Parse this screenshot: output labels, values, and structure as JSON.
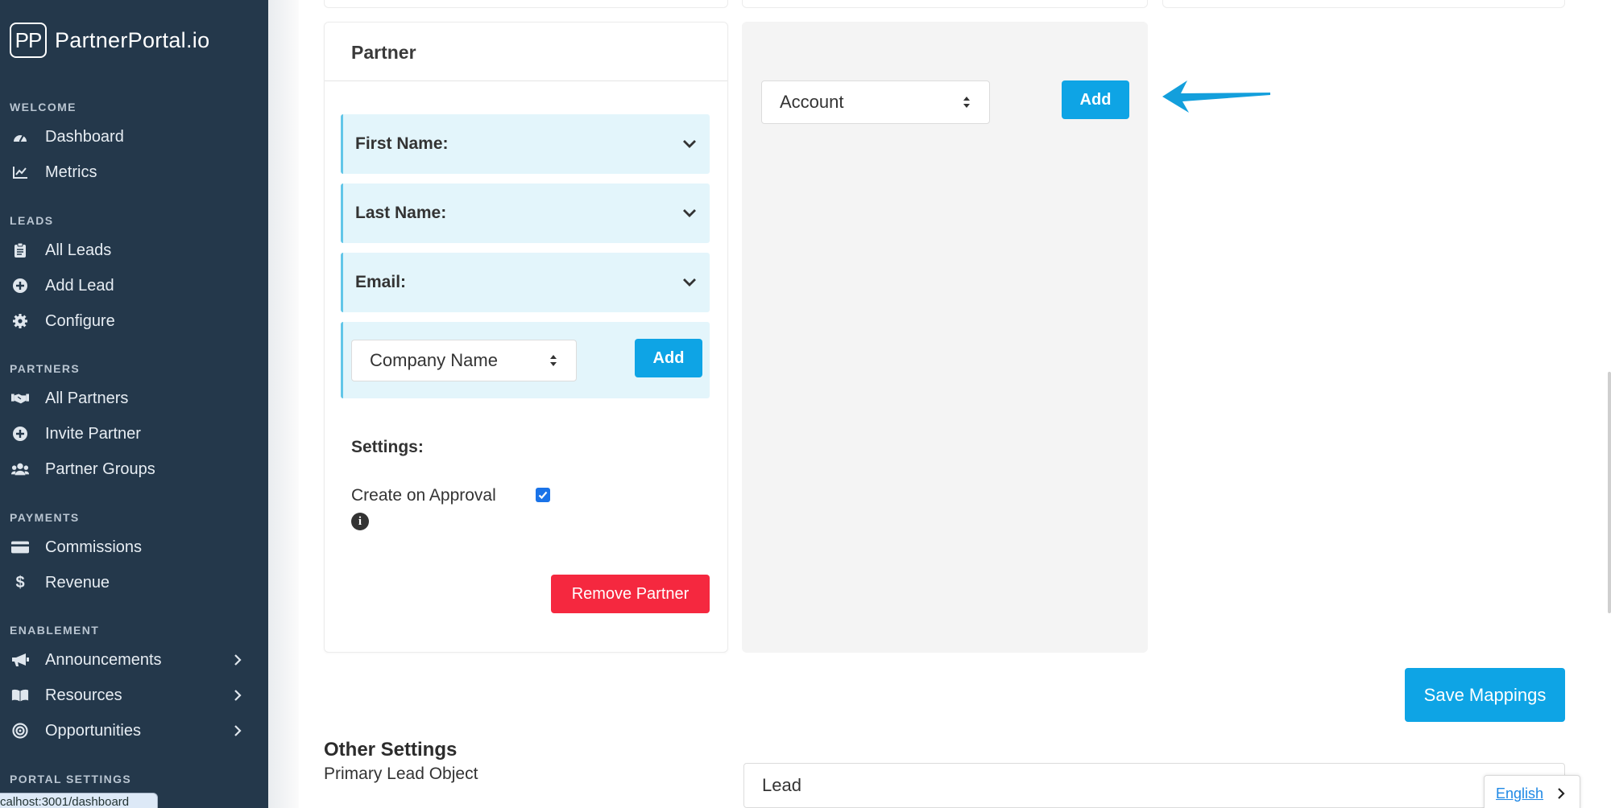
{
  "brand": {
    "mark": "PP",
    "name": "PartnerPortal.io"
  },
  "sidebar": {
    "sections": [
      {
        "label": "WELCOME",
        "items": [
          {
            "label": "Dashboard",
            "icon": "gauge-icon"
          },
          {
            "label": "Metrics",
            "icon": "chart-line-icon"
          }
        ]
      },
      {
        "label": "LEADS",
        "items": [
          {
            "label": "All Leads",
            "icon": "clipboard-icon"
          },
          {
            "label": "Add Lead",
            "icon": "plus-circle-icon"
          },
          {
            "label": "Configure",
            "icon": "gear-icon"
          }
        ]
      },
      {
        "label": "PARTNERS",
        "items": [
          {
            "label": "All Partners",
            "icon": "handshake-icon"
          },
          {
            "label": "Invite Partner",
            "icon": "plus-circle-icon"
          },
          {
            "label": "Partner Groups",
            "icon": "users-icon"
          }
        ]
      },
      {
        "label": "PAYMENTS",
        "items": [
          {
            "label": "Commissions",
            "icon": "credit-card-icon"
          },
          {
            "label": "Revenue",
            "icon": "dollar-icon"
          }
        ]
      },
      {
        "label": "ENABLEMENT",
        "items": [
          {
            "label": "Announcements",
            "icon": "megaphone-icon",
            "has_chevron": true
          },
          {
            "label": "Resources",
            "icon": "book-icon",
            "has_chevron": true
          },
          {
            "label": "Opportunities",
            "icon": "target-icon",
            "has_chevron": true
          }
        ]
      },
      {
        "label": "PORTAL SETTINGS",
        "items": []
      }
    ]
  },
  "status_url": "calhost:3001/dashboard",
  "partner_card": {
    "title": "Partner",
    "fields": [
      "First Name:",
      "Last Name:",
      "Email:"
    ],
    "add_select_value": "Company Name",
    "add_button": "Add",
    "settings_title": "Settings:",
    "create_on_approval_label": "Create on Approval",
    "create_on_approval_checked": true,
    "remove_button": "Remove Partner"
  },
  "account_panel": {
    "select_value": "Account",
    "add_button": "Add"
  },
  "save_mappings_button": "Save Mappings",
  "other_settings": {
    "heading": "Other Settings",
    "primary_lead_object_label": "Primary Lead Object",
    "primary_lead_object_value": "Lead"
  },
  "language": {
    "label": "English"
  },
  "colors": {
    "sidebar_bg": "#24384b",
    "accent_blue": "#0ea4e5",
    "danger_red": "#f5283f",
    "field_bg": "#e3f5fb",
    "field_border": "#62c6e8",
    "annotation_arrow": "#139fdc"
  }
}
